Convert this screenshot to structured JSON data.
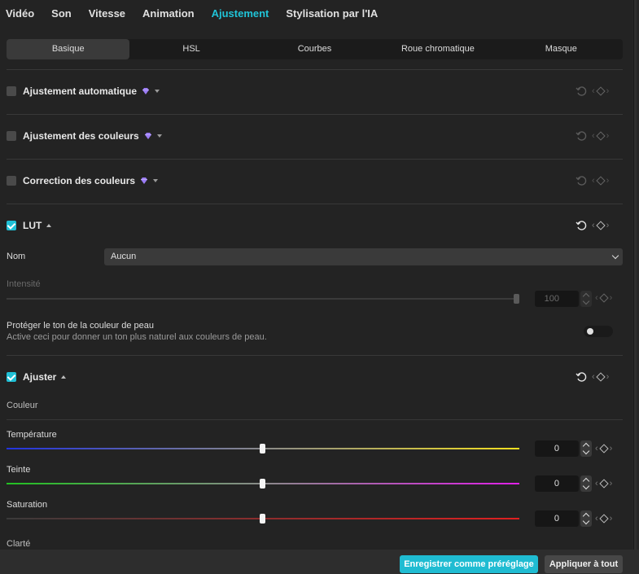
{
  "nav": {
    "tabs": [
      "Vidéo",
      "Son",
      "Vitesse",
      "Animation",
      "Ajustement",
      "Stylisation par l'IA"
    ],
    "active": "Ajustement"
  },
  "subtabs": {
    "items": [
      "Basique",
      "HSL",
      "Courbes",
      "Roue chromatique",
      "Masque"
    ],
    "active": "Basique"
  },
  "sections": {
    "auto": {
      "label": "Ajustement automatique",
      "checked": false,
      "premium": true
    },
    "colors": {
      "label": "Ajustement des couleurs",
      "checked": false,
      "premium": true
    },
    "correction": {
      "label": "Correction des couleurs",
      "checked": false,
      "premium": true
    },
    "lut": {
      "label": "LUT",
      "checked": true
    },
    "adjust": {
      "label": "Ajuster",
      "checked": true
    }
  },
  "lut": {
    "name_label": "Nom",
    "name_value": "Aucun",
    "intensity_label": "Intensité",
    "intensity_value": "100",
    "skin_title": "Protéger le ton de la couleur de peau",
    "skin_desc": "Active ceci pour donner un ton plus naturel aux couleurs de peau.",
    "skin_enabled": false
  },
  "adjust": {
    "group_label": "Couleur",
    "temperature_label": "Température",
    "temperature_value": "0",
    "tint_label": "Teinte",
    "tint_value": "0",
    "saturation_label": "Saturation",
    "saturation_value": "0",
    "clarity_label": "Clarté"
  },
  "footer": {
    "save_preset": "Enregistrer comme préréglage",
    "apply_all": "Appliquer à tout"
  },
  "colors": {
    "accent": "#1fbcd2",
    "premium": "#9b7cf5",
    "temperature_gradient": [
      "#2233dd",
      "#f4e020"
    ],
    "tint_gradient": [
      "#22c022",
      "#e020e8"
    ],
    "saturation_gradient": [
      "#3a3a3a",
      "#e02020"
    ]
  }
}
